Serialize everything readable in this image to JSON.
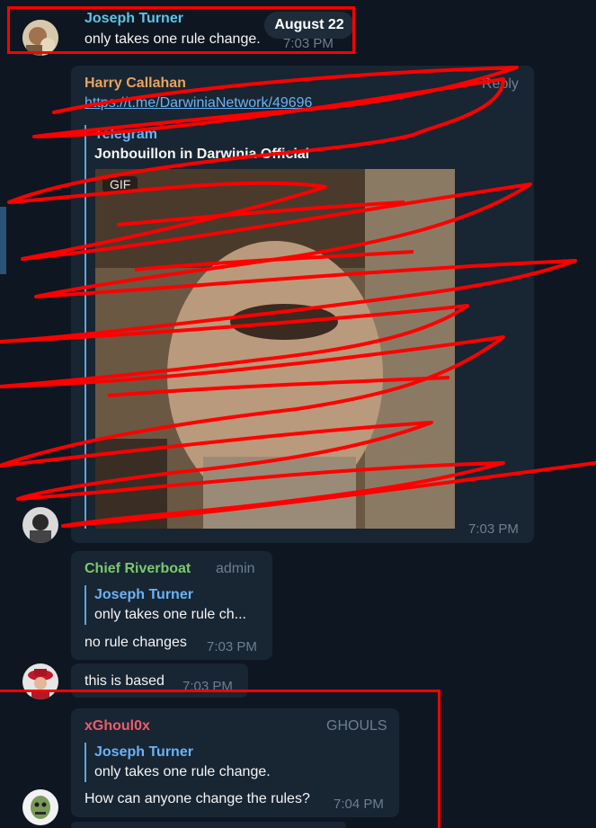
{
  "date_badge": "August 22",
  "messages": {
    "m1": {
      "sender": "Joseph Turner",
      "text": "only takes one rule change.",
      "time": "7:03 PM"
    },
    "m2": {
      "sender": "Harry Callahan",
      "reply_label": "Reply",
      "link": "https://t.me/DarwiniaNetwork/49696",
      "preview_site": "Telegram",
      "preview_title": "Jonbouillon in Darwinia Official",
      "gif_badge": "GIF",
      "time": "7:03 PM"
    },
    "m3": {
      "sender": "Chief Riverboat",
      "tag": "admin",
      "quote_name": "Joseph Turner",
      "quote_text": "only takes one rule ch...",
      "text": "no rule changes",
      "time": "7:03 PM"
    },
    "m4": {
      "text": "this is based",
      "time": "7:03 PM"
    },
    "m5": {
      "sender": "xGhoul0x",
      "tag": "GHOULS",
      "quote_name": "Joseph Turner",
      "quote_text": "only takes one rule change.",
      "text": "How can anyone change the rules?",
      "time": "7:04 PM"
    }
  },
  "colors": {
    "background": "#0e1621",
    "bubble": "#182533",
    "name_joseph": "#5fc3e4",
    "name_harry": "#e8a45c",
    "name_chief": "#7cc86d",
    "name_ghoul": "#ec5c6b",
    "annotation": "#ff0000"
  },
  "icons": [
    "avatar-joseph",
    "avatar-harry",
    "avatar-redhat",
    "avatar-ghoul"
  ]
}
